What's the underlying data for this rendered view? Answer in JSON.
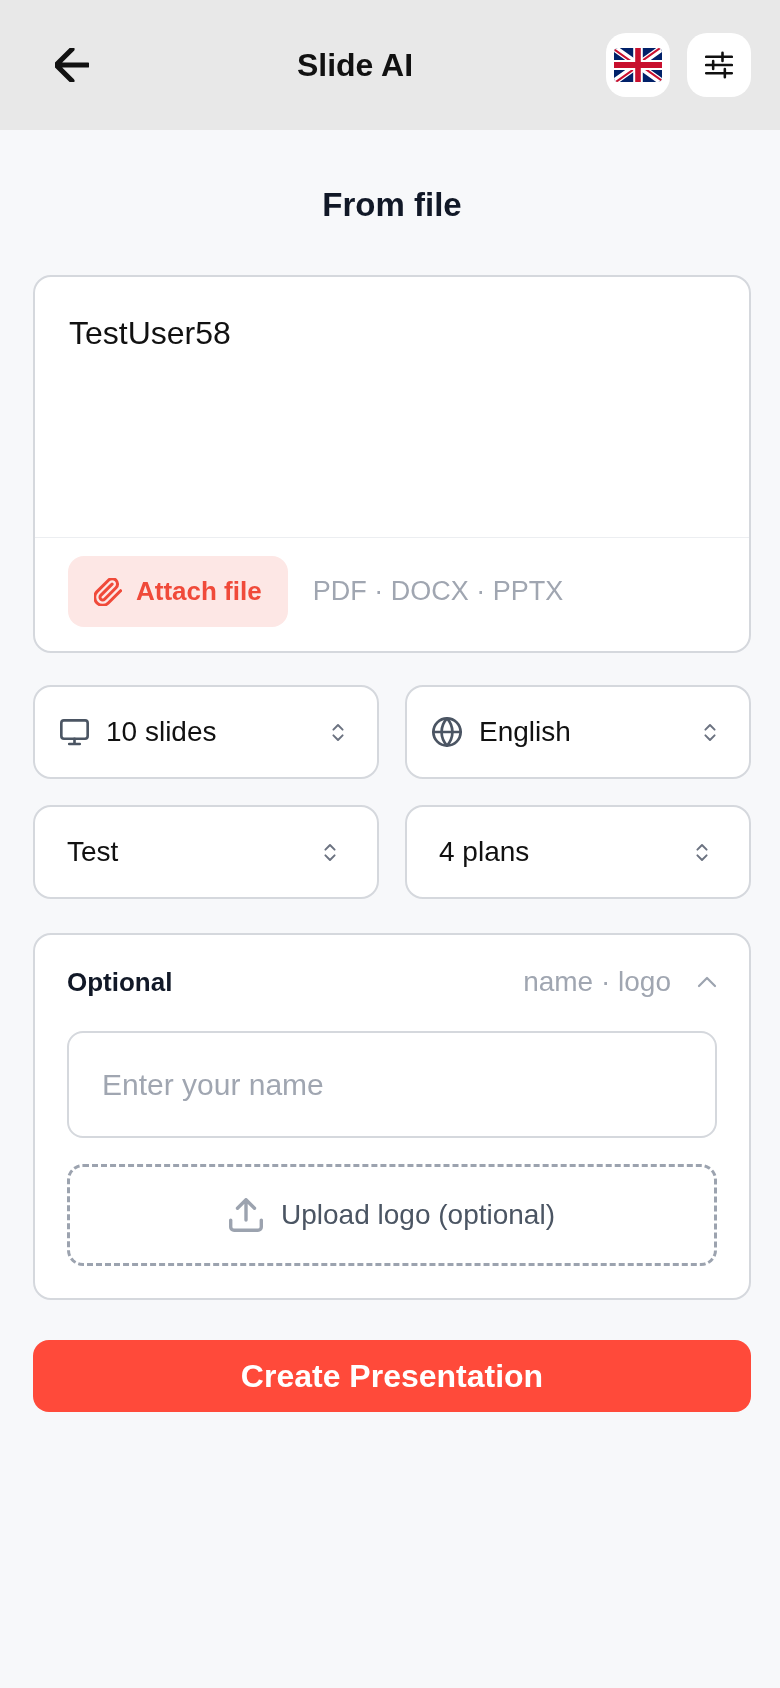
{
  "header": {
    "title": "Slide AI"
  },
  "page_title": "From file",
  "prompt": {
    "value": "TestUser58",
    "attach_button": "Attach file",
    "formats": "PDF · DOCX · PPTX"
  },
  "selects": [
    {
      "kind": "slides",
      "value": "10 slides"
    },
    {
      "kind": "language",
      "value": "English"
    },
    {
      "kind": "plain",
      "value": "Test"
    },
    {
      "kind": "plain",
      "value": "4 plans"
    }
  ],
  "optional": {
    "title": "Optional",
    "summary": "name · logo",
    "expanded": true,
    "name_field": {
      "placeholder": "Enter your name"
    },
    "upload_button": "Upload logo (optional)"
  },
  "create_button": "Create Presentation"
}
